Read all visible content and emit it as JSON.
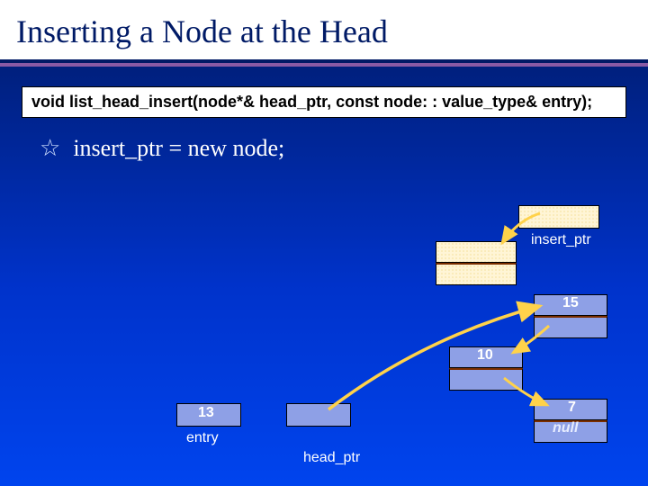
{
  "title": "Inserting a Node at the Head",
  "signature": "void list_head_insert(node*& head_ptr, const node: : value_type& entry);",
  "bullet": "insert_ptr = new node;",
  "labels": {
    "insert_ptr": "insert_ptr",
    "head_ptr": "head_ptr",
    "entry": "entry",
    "null": "null"
  },
  "values": {
    "entry": "13",
    "n1": "15",
    "n2": "10",
    "n3": "7"
  }
}
